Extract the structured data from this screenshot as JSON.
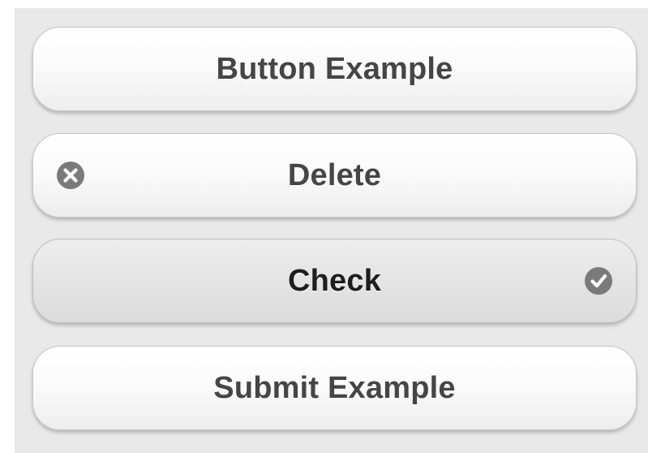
{
  "buttons": {
    "button_example": {
      "label": "Button Example"
    },
    "delete": {
      "label": "Delete",
      "icon": "delete-icon"
    },
    "check": {
      "label": "Check",
      "icon": "check-icon",
      "state": "active"
    },
    "submit_example": {
      "label": "Submit Example"
    }
  },
  "colors": {
    "panel_background": "#e9e9e9",
    "button_text": "#454545",
    "active_button_text": "#1e1e1e",
    "icon_fill": "#7a7a7a"
  }
}
